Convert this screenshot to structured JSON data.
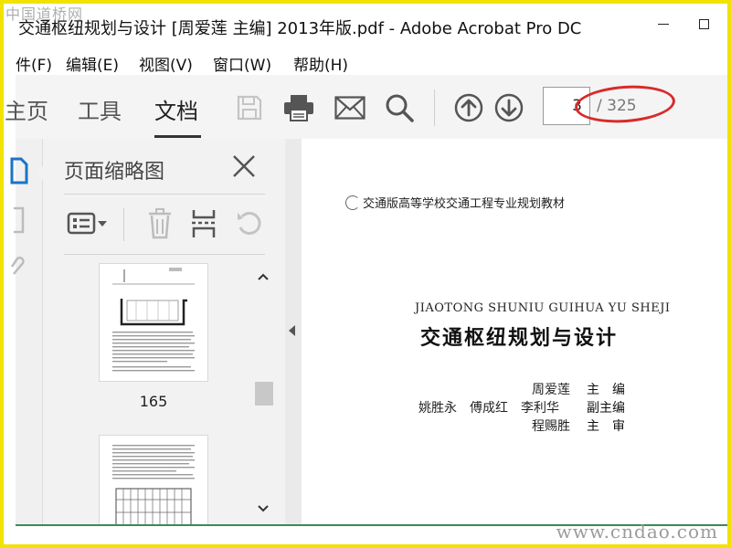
{
  "watermark": {
    "top": "中国道桥网",
    "bottom": "www.cndao.com"
  },
  "window": {
    "title": "交通枢纽规划与设计 [周爱莲 主编] 2013年版.pdf - Adobe Acrobat Pro DC"
  },
  "menu": [
    "件(F)",
    "编辑(E)",
    "视图(V)",
    "窗口(W)",
    "帮助(H)"
  ],
  "toolbar": {
    "tabs": [
      "主页",
      "工具",
      "文档"
    ],
    "active_tab": "文档",
    "icons": [
      "save-icon",
      "print-icon",
      "mail-icon",
      "search-icon",
      "arrow-up-circle-icon",
      "arrow-down-circle-icon"
    ],
    "page_current": "3",
    "page_total": "/ 325"
  },
  "thumbnails_panel": {
    "title": "页面缩略图",
    "tools": [
      "thumbnail-options-icon",
      "delete-icon",
      "extract-icon",
      "rotate-icon"
    ],
    "thumbnails": [
      {
        "label": "165"
      },
      {
        "label": ""
      }
    ]
  },
  "document": {
    "series": "交通版高等学校交通工程专业规划教材",
    "pinyin": "JIAOTONG SHUNIU GUIHUA YU SHEJI",
    "title": "交通枢纽规划与设计",
    "credits": [
      {
        "names": "周爱莲",
        "role": "主　编"
      },
      {
        "names": "姚胜永　傅成红　李利华",
        "role": "副主编"
      },
      {
        "names": "程赐胜",
        "role": "主　审"
      }
    ]
  },
  "colors": {
    "annotation": "#d82a2a",
    "frame": "#f2e200",
    "toolbar_bg": "#f4f4f4"
  }
}
